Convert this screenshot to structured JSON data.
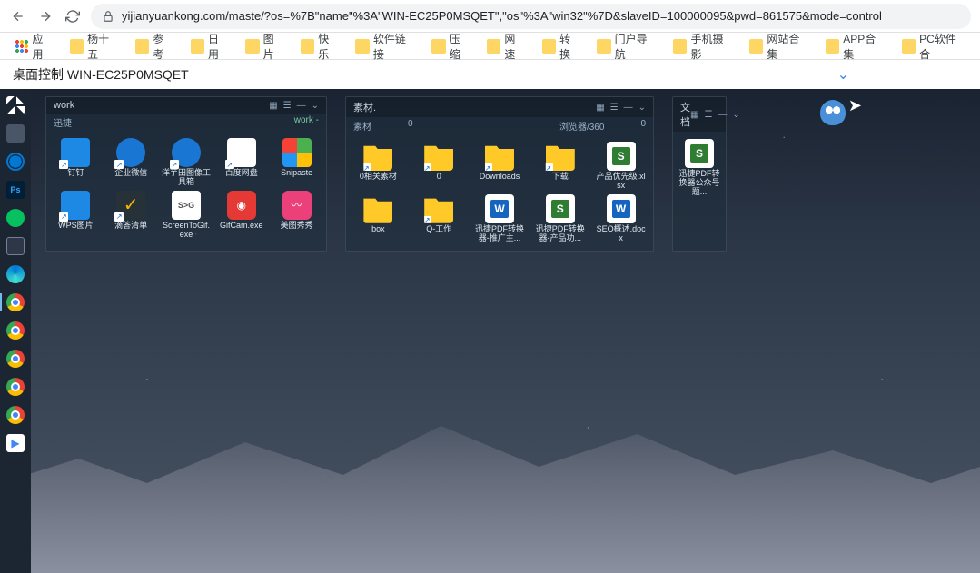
{
  "browser": {
    "url": "yijianyuankong.com/maste/?os=%7B\"name\"%3A\"WIN-EC25P0MSQET\",\"os\"%3A\"win32\"%7D&slaveID=100000095&pwd=861575&mode=control"
  },
  "bookmarks": [
    {
      "label": "应用",
      "apps": true
    },
    {
      "label": "杨十五"
    },
    {
      "label": "参考"
    },
    {
      "label": "日用"
    },
    {
      "label": "图片"
    },
    {
      "label": "快乐"
    },
    {
      "label": "软件链接"
    },
    {
      "label": "压缩"
    },
    {
      "label": "网速"
    },
    {
      "label": "转换"
    },
    {
      "label": "门户导航"
    },
    {
      "label": "手机摄影"
    },
    {
      "label": "网站合集"
    },
    {
      "label": "APP合集"
    },
    {
      "label": "PC软件合"
    }
  ],
  "page": {
    "title": "桌面控制 WIN-EC25P0MSQET"
  },
  "taskbar": [
    {
      "name": "start",
      "kind": "win"
    },
    {
      "name": "task-view",
      "kind": "generic"
    },
    {
      "name": "ie",
      "kind": "edge-old"
    },
    {
      "name": "photoshop",
      "kind": "ps",
      "text": "Ps"
    },
    {
      "name": "wechat",
      "kind": "wechat"
    },
    {
      "name": "monitor",
      "kind": "mon"
    },
    {
      "name": "edge",
      "kind": "edge"
    },
    {
      "name": "chrome1",
      "kind": "chrome",
      "active": true
    },
    {
      "name": "chrome2",
      "kind": "chrome"
    },
    {
      "name": "chrome3",
      "kind": "chrome"
    },
    {
      "name": "chrome4",
      "kind": "chrome"
    },
    {
      "name": "chrome5",
      "kind": "chrome"
    },
    {
      "name": "player",
      "kind": "play",
      "text": "▶"
    }
  ],
  "fences": [
    {
      "title": "work",
      "sub_left": "迅捷",
      "sub_right": "work -",
      "w": "w1",
      "icons": [
        {
          "label": "钉钉",
          "kind": "blue",
          "shortcut": true
        },
        {
          "label": "企业微信",
          "kind": "round-blue",
          "shortcut": true
        },
        {
          "label": "洋芋田图像工具箱",
          "kind": "round-blue",
          "shortcut": true
        },
        {
          "label": "百度网盘",
          "kind": "white",
          "shortcut": true
        },
        {
          "label": "Snipaste",
          "kind": "tiles"
        },
        {
          "label": "WPS图片",
          "kind": "blue",
          "shortcut": true
        },
        {
          "label": "滴答清单",
          "kind": "check",
          "text": "✓",
          "shortcut": true
        },
        {
          "label": "ScreenToGif.exe",
          "kind": "svg",
          "text": "S>G"
        },
        {
          "label": "GifCam.exe",
          "kind": "cam",
          "text": "◉"
        },
        {
          "label": "美图秀秀",
          "kind": "pink",
          "text": "〰"
        }
      ]
    },
    {
      "title": "素材.",
      "sub_left": "素材",
      "sub_mid": "0",
      "sub_right2": "浏览器/360",
      "sub_right3": "0",
      "w": "w2",
      "icons": [
        {
          "label": "0相关素材",
          "kind": "folder",
          "shortcut": true
        },
        {
          "label": "0",
          "kind": "folder",
          "shortcut": true
        },
        {
          "label": "Downloads",
          "kind": "folder",
          "shortcut": true
        },
        {
          "label": "下载",
          "kind": "folder",
          "shortcut": true
        },
        {
          "label": "产品优先级.xlsx",
          "kind": "xls"
        },
        {
          "label": "box",
          "kind": "folder"
        },
        {
          "label": "Q-工作",
          "kind": "folder",
          "shortcut": true
        },
        {
          "label": "迅捷PDF转换器-推广主...",
          "kind": "word"
        },
        {
          "label": "迅捷PDF转换器-产品功...",
          "kind": "xls"
        },
        {
          "label": "SEO概述.docx",
          "kind": "word"
        }
      ]
    },
    {
      "title": "文档",
      "w": "w3",
      "icons": [
        {
          "label": "迅捷PDF转换器公众号题...",
          "kind": "xls"
        }
      ]
    }
  ]
}
